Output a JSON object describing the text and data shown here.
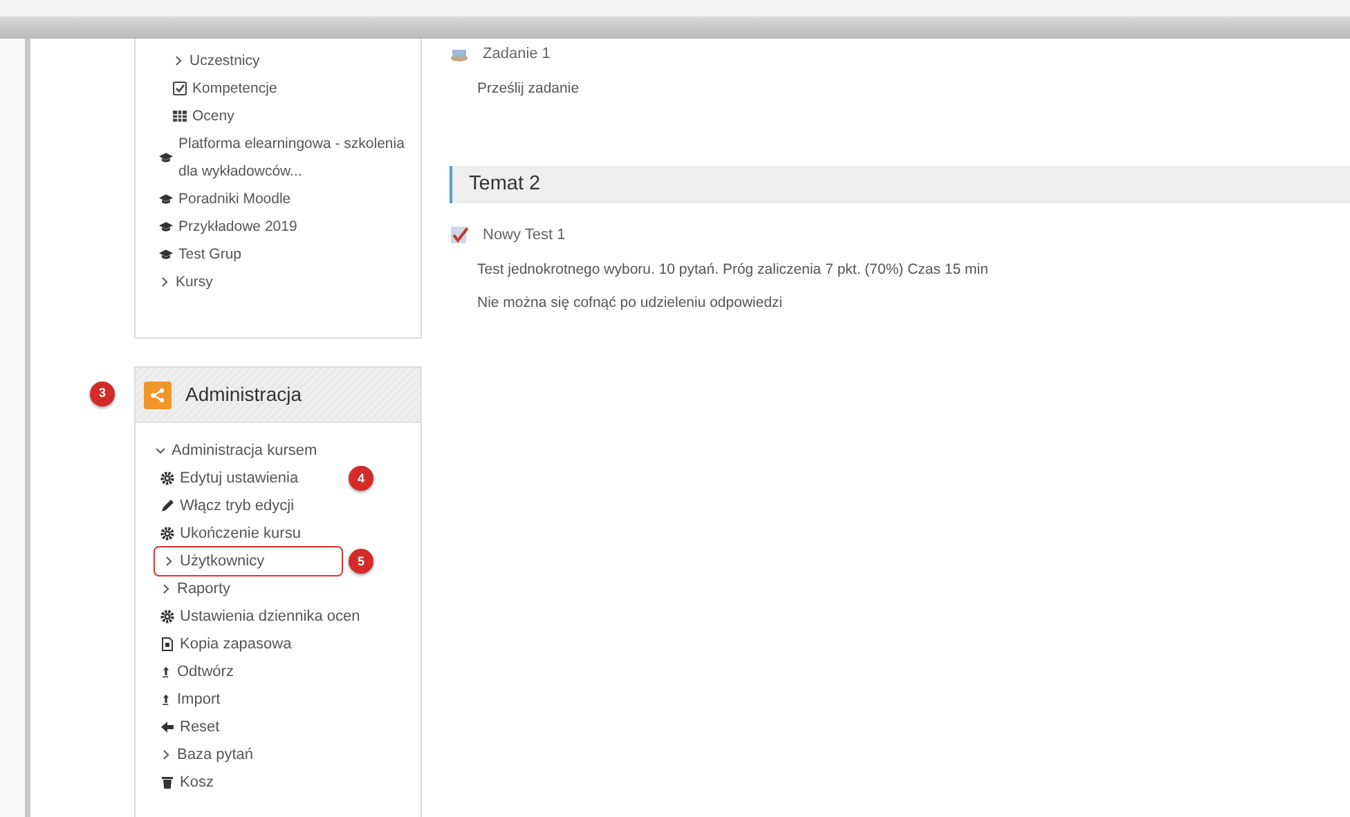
{
  "navigation": {
    "items": [
      {
        "children": [
          {
            "label": "Uczestnicy",
            "kind": "branch"
          },
          {
            "label": "Kompetencje",
            "kind": "competencies"
          },
          {
            "label": "Oceny",
            "kind": "grades"
          }
        ]
      },
      {
        "label": "Platforma elearningowa - szkolenia dla wykładowców...",
        "kind": "course"
      },
      {
        "label": "Poradniki Moodle",
        "kind": "course"
      },
      {
        "label": "Przykładowe 2019",
        "kind": "course"
      },
      {
        "label": "Test Grup",
        "kind": "course"
      },
      {
        "label": "Kursy",
        "kind": "branch"
      }
    ]
  },
  "administration": {
    "title": "Administracja",
    "callout": "3",
    "items": [
      {
        "label": "Administracja kursem",
        "kind": "branch",
        "expanded": true,
        "children": [
          {
            "label": "Edytuj ustawienia",
            "kind": "settings",
            "callout": "4"
          },
          {
            "label": "Włącz tryb edycji",
            "kind": "edit"
          },
          {
            "label": "Ukończenie kursu",
            "kind": "settings"
          },
          {
            "label": "Użytkownicy",
            "kind": "branch",
            "highlighted": true,
            "callout": "5"
          },
          {
            "label": "Raporty",
            "kind": "branch"
          },
          {
            "label": "Ustawienia dziennika ocen",
            "kind": "settings"
          },
          {
            "label": "Kopia zapasowa",
            "kind": "backup"
          },
          {
            "label": "Odtwórz",
            "kind": "restore"
          },
          {
            "label": "Import",
            "kind": "restore"
          },
          {
            "label": "Reset",
            "kind": "reset"
          },
          {
            "label": "Baza pytań",
            "kind": "branch"
          },
          {
            "label": "Kosz",
            "kind": "trash"
          }
        ]
      }
    ]
  },
  "sections": [
    {
      "activities": [
        {
          "kind": "assignment",
          "name": "Zadanie 1",
          "description": [
            "Prześlij zadanie"
          ]
        }
      ]
    },
    {
      "title": "Temat 2",
      "activities": [
        {
          "kind": "quiz",
          "name": "Nowy Test 1",
          "description": [
            "Test jednokrotnego wyboru. 10 pytań. Próg zaliczenia 7 pkt. (70%) Czas 15 min",
            "Nie można się cofnąć po udzieleniu odpowiedzi"
          ]
        }
      ]
    }
  ]
}
